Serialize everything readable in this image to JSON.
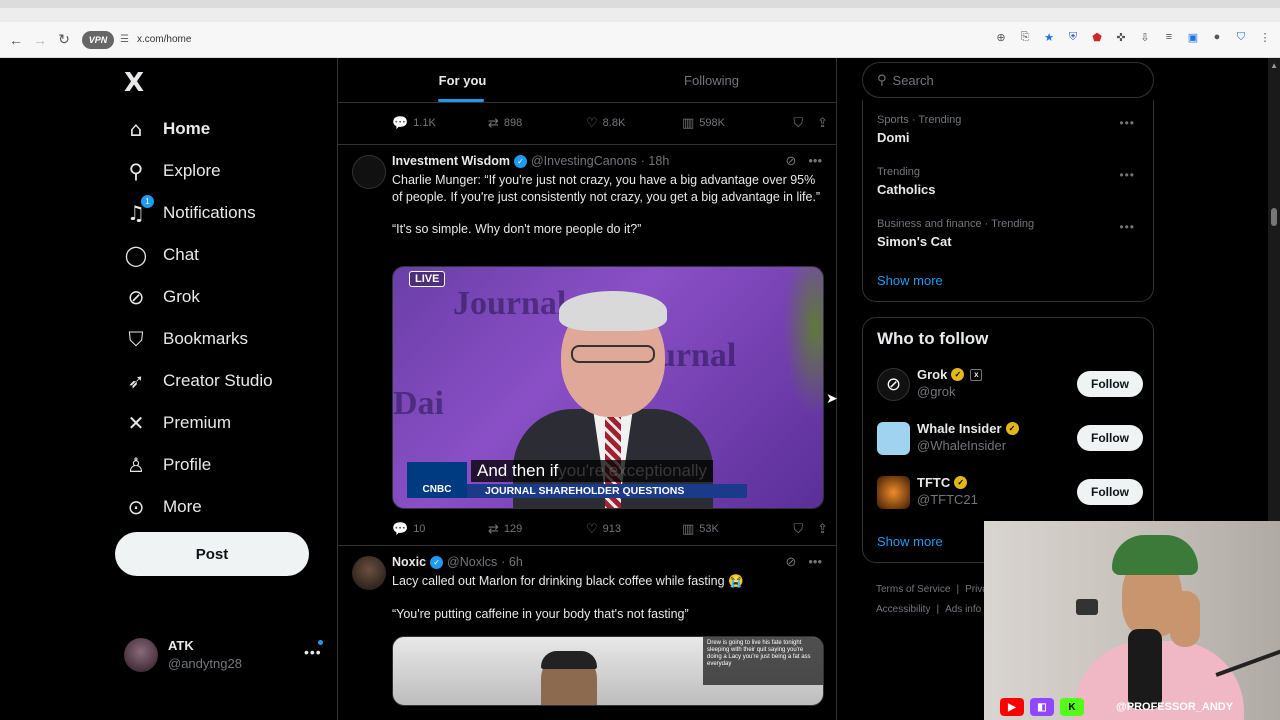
{
  "browser": {
    "url": "x.com/home",
    "vpn_label": "VPN"
  },
  "nav": {
    "logo": "X",
    "items": [
      {
        "label": "Home",
        "icon": "home-icon",
        "glyph": "⌂"
      },
      {
        "label": "Explore",
        "icon": "search-icon",
        "glyph": "⚲"
      },
      {
        "label": "Notifications",
        "icon": "bell-icon",
        "glyph": "♫",
        "badge": "1"
      },
      {
        "label": "Chat",
        "icon": "chat-icon",
        "glyph": "◯"
      },
      {
        "label": "Grok",
        "icon": "grok-icon",
        "glyph": "⊘"
      },
      {
        "label": "Bookmarks",
        "icon": "bookmark-icon",
        "glyph": "⛉"
      },
      {
        "label": "Creator Studio",
        "icon": "rocket-icon",
        "glyph": "➶"
      },
      {
        "label": "Premium",
        "icon": "x-premium-icon",
        "glyph": "✕"
      },
      {
        "label": "Profile",
        "icon": "person-icon",
        "glyph": "♙"
      },
      {
        "label": "More",
        "icon": "more-circle-icon",
        "glyph": "⊙"
      }
    ],
    "post_label": "Post"
  },
  "account": {
    "name": "ATK",
    "handle": "@andytng28"
  },
  "timeline": {
    "tabs": [
      "For you",
      "Following"
    ],
    "prev_actions": {
      "replies": "1.1K",
      "reposts": "898",
      "likes": "8.8K",
      "views": "598K"
    },
    "tweets": [
      {
        "name": "Investment Wisdom",
        "handle": "@InvestingCanons",
        "time": "· 18h",
        "text1": "Charlie Munger: “If you're just not crazy, you have a big advantage over 95% of people. If you're just consistently not crazy, you get a big advantage in life.”",
        "text2": "“It's so simple. Why don't more people do it?”",
        "video": {
          "live": "LIVE",
          "bg_text_1": "Journal",
          "bg_text_2": "Journal",
          "bg_text_3": "Dai",
          "caption_main": "And then if",
          "caption_dim": " you're exceptionally",
          "network": "CNBC",
          "chyron": "JOURNAL SHAREHOLDER QUESTIONS"
        },
        "actions": {
          "replies": "10",
          "reposts": "129",
          "likes": "913",
          "views": "53K"
        }
      },
      {
        "name": "Noxic",
        "handle": "@Noxlcs",
        "time": "· 6h",
        "text1": "Lacy called out Marlon for drinking black coffee while fasting 😭",
        "text2": "“You're putting caffeine in your body that's not fasting”",
        "overlay": "Drew is going to live his fate tonight sleeping with their quit saying you're doing a Lacy you're just being a fat ass everyday"
      }
    ]
  },
  "right": {
    "search_placeholder": "Search",
    "trends": [
      {
        "meta": "Sports · Trending",
        "name": "Domi"
      },
      {
        "meta": "Trending",
        "name": "Catholics"
      },
      {
        "meta": "Business and finance · Trending",
        "name": "Simon's Cat"
      }
    ],
    "show_more": "Show more",
    "wtf_title": "Who to follow",
    "follow": [
      {
        "name": "Grok",
        "handle": "@grok",
        "badge_x": "x"
      },
      {
        "name": "Whale Insider",
        "handle": "@WhaleInsider"
      },
      {
        "name": "TFTC",
        "handle": "@TFTC21"
      }
    ],
    "follow_label": "Follow",
    "show_more_2": "Show more",
    "footer": {
      "terms": "Terms of Service",
      "privacy": "Priva",
      "accessibility": "Accessibility",
      "ads": "Ads info"
    }
  },
  "stream": {
    "handle": "@PROFESSOR_ANDY",
    "platforms": [
      "youtube",
      "twitch",
      "kick"
    ]
  },
  "colors": {
    "accent": "#1d9bf0",
    "verified_gold": "#e2b719"
  }
}
